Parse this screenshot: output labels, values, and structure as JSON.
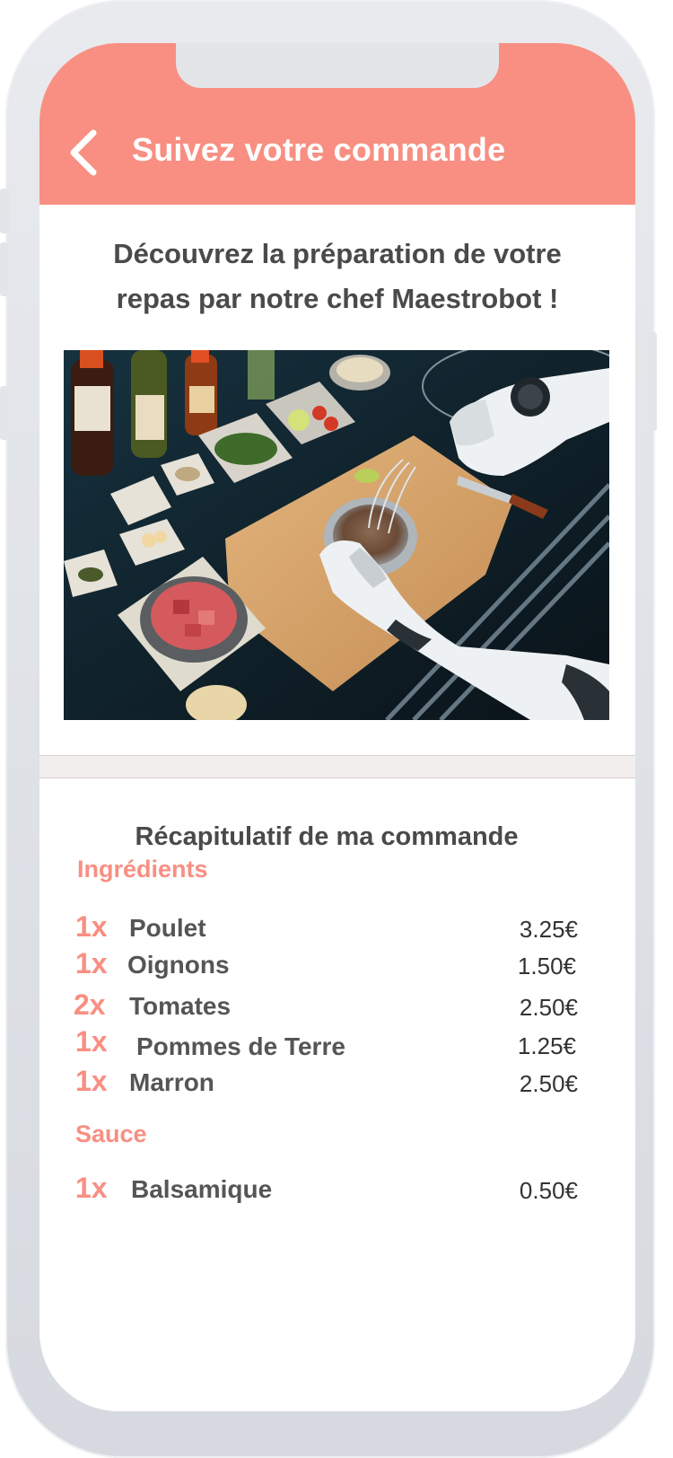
{
  "header": {
    "title": "Suivez votre commande"
  },
  "intro": {
    "line1": "Découvrez la préparation de votre",
    "line2": "repas par notre chef Maestrobot !"
  },
  "summary": {
    "title": "Récapitulatif de ma commande",
    "sections": [
      {
        "label": "Ingrédients",
        "items": [
          {
            "qty": "1x",
            "name": "Poulet",
            "price": "3.25€"
          },
          {
            "qty": "1x",
            "name": "Oignons",
            "price": "1.50€"
          },
          {
            "qty": "2x",
            "name": "Tomates",
            "price": "2.50€"
          },
          {
            "qty": "1x",
            "name": "Pommes de Terre",
            "price": "1.25€"
          },
          {
            "qty": "1x",
            "name": "Marron",
            "price": "2.50€"
          }
        ]
      },
      {
        "label": "Sauce",
        "items": [
          {
            "qty": "1x",
            "name": "Balsamique",
            "price": "0.50€"
          }
        ]
      }
    ]
  },
  "colors": {
    "accent": "#f88f82",
    "text": "#4a4a4a",
    "frame": "#e3e5e9"
  },
  "icons": {
    "back": "chevron-left-icon"
  }
}
